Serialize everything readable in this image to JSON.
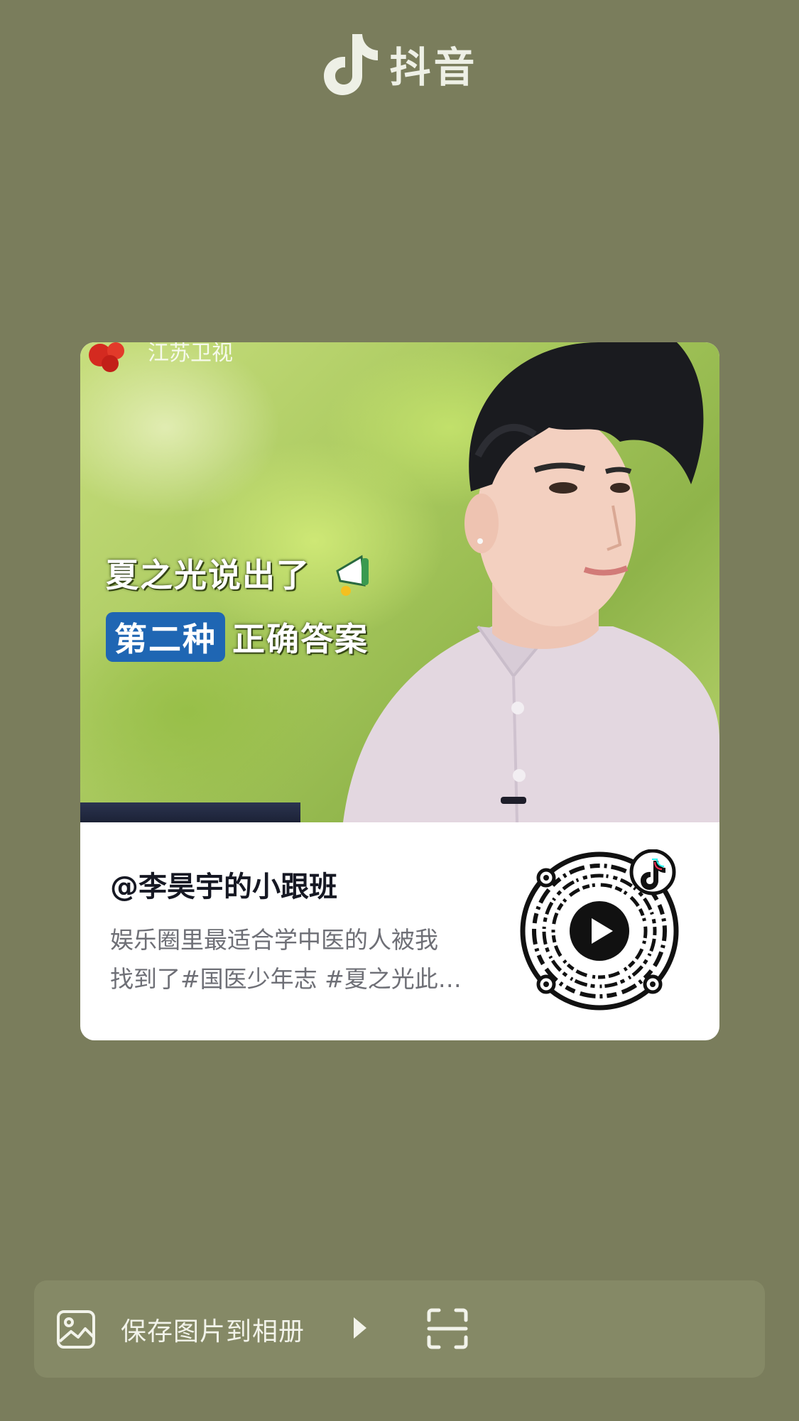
{
  "header": {
    "app_name": "抖音"
  },
  "card": {
    "cover": {
      "station_text": "江苏卫视",
      "caption_line1": "夏之光说出了",
      "caption_highlight": "第二种",
      "caption_rest": "正确答案"
    },
    "author": "@李昊宇的小跟班",
    "description_lines": [
      "娱乐圈里最适合学中医的人被我",
      "找到了#国医少年志 #夏之光此…"
    ]
  },
  "action_bar": {
    "save_label": "保存图片到相册"
  },
  "colors": {
    "background": "#7a7d5c",
    "action_bar": "#858966",
    "highlight_blue": "#1f66b3"
  }
}
